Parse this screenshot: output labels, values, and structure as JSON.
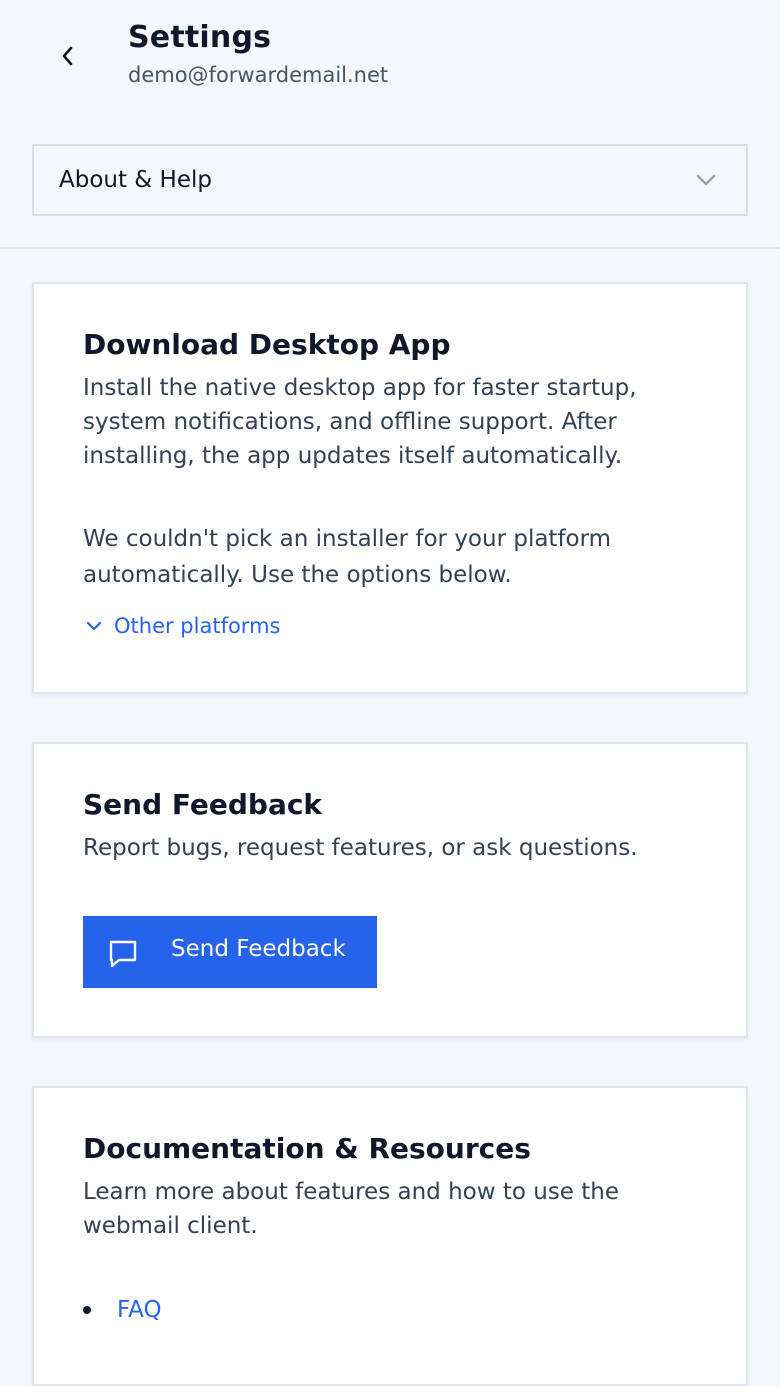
{
  "header": {
    "title": "Settings",
    "email": "demo@forwardemail.net"
  },
  "section_select": {
    "value": "About & Help"
  },
  "desktop_app": {
    "title": "Download Desktop App",
    "description": "Install the native desktop app for faster startup, system notifications, and offline support. After installing, the app updates itself automatically.",
    "notice": "We couldn't pick an installer for your platform automatically. Use the options below.",
    "other_platforms_label": "Other platforms"
  },
  "feedback": {
    "title": "Send Feedback",
    "description": "Report bugs, request features, or ask questions.",
    "button_label": "Send Feedback"
  },
  "docs": {
    "title": "Documentation & Resources",
    "description": "Learn more about features and how to use the webmail client.",
    "links": [
      "FAQ"
    ]
  },
  "colors": {
    "accent": "#2563eb",
    "background": "#f4f7fc",
    "card": "#ffffff"
  }
}
